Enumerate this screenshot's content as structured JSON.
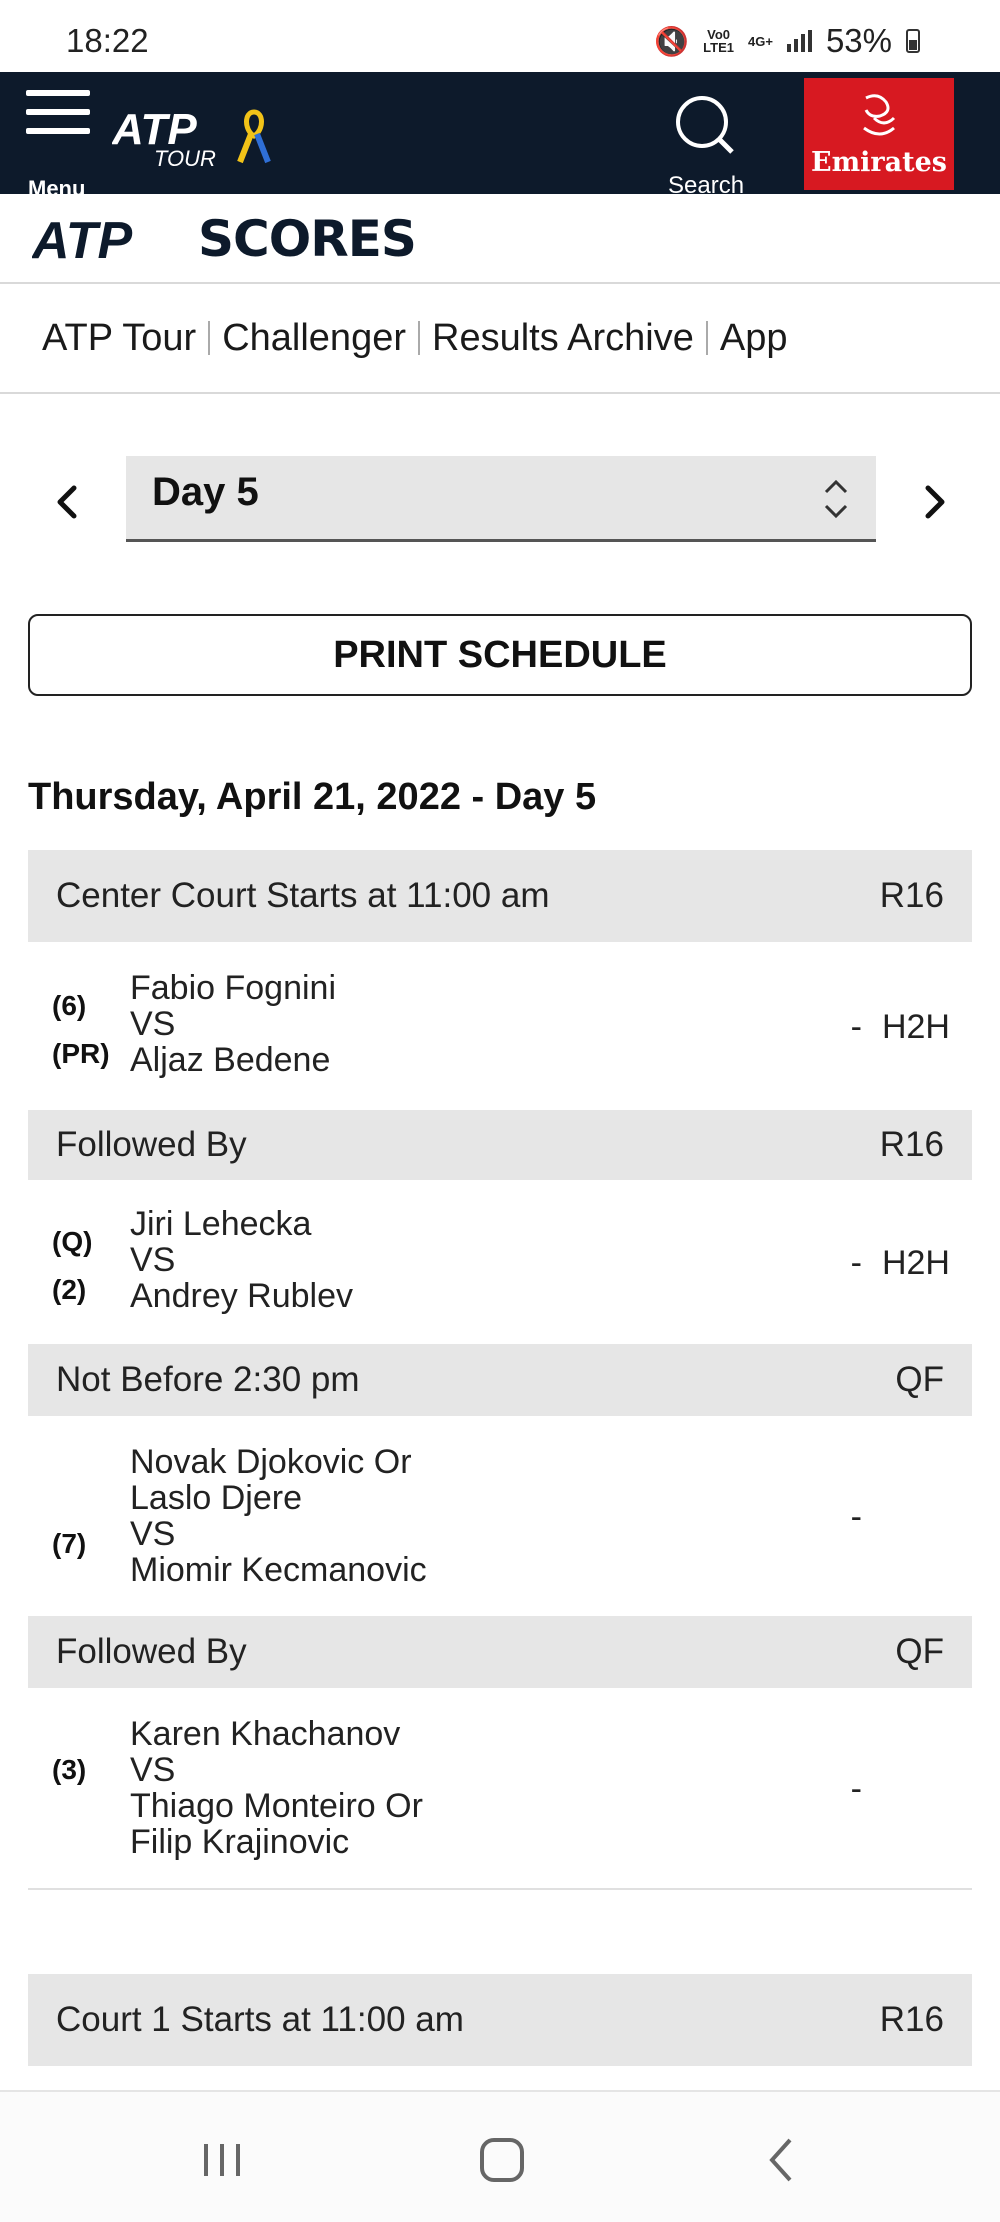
{
  "status_bar": {
    "time": "18:22",
    "net_top": "Vo0",
    "net_bottom": "LTE1",
    "net_gen": "4G+",
    "battery": "53%"
  },
  "header": {
    "menu_label": "Menu",
    "logo_text": "ATP",
    "logo_sub": "TOUR",
    "search_label": "Search",
    "sponsor": "Emirates"
  },
  "scores_bar": {
    "logo_text": "ATP",
    "title": "SCORES"
  },
  "nav": {
    "tabs": [
      "ATP Tour",
      "Challenger",
      "Results Archive",
      "App"
    ]
  },
  "day_selector": {
    "value": "Day 5"
  },
  "print_button": "PRINT SCHEDULE",
  "schedule": {
    "date_heading": "Thursday, April 21, 2022  - Day 5",
    "court_header": {
      "label": "Center Court  Starts at 11:00 am",
      "round": "R16"
    },
    "blocks": [
      {
        "player1": "Fabio Fognini",
        "vs": "VS",
        "player2": "Aljaz Bedene",
        "seed1": "(6)",
        "seed2": "(PR)",
        "dash": "-",
        "h2h": "H2H"
      },
      {
        "header": "Followed By",
        "round": "R16",
        "player1": "Jiri Lehecka",
        "vs": "VS",
        "player2": "Andrey Rublev",
        "seed1": "(Q)",
        "seed2": "(2)",
        "dash": "-",
        "h2h": "H2H"
      },
      {
        "header": "Not Before 2:30 pm",
        "round": "QF",
        "line1": "Novak Djokovic Or",
        "line2": "Laslo Djere",
        "vs": "VS",
        "line3": "Miomir Kecmanovic",
        "seed": "(7)",
        "dash": "-"
      },
      {
        "header": "Followed By",
        "round": "QF",
        "line1": "Karen Khachanov",
        "vs": "VS",
        "line2": "Thiago Monteiro Or",
        "line3": "Filip Krajinovic",
        "seed": "(3)",
        "dash": "-"
      }
    ],
    "court2_header": {
      "label": "Court 1  Starts at 11:00 am",
      "round": "R16"
    }
  },
  "colors": {
    "header_bg": "#0d1a2b",
    "sponsor_red": "#d71921",
    "row_header_bg": "#e6e6e6"
  }
}
